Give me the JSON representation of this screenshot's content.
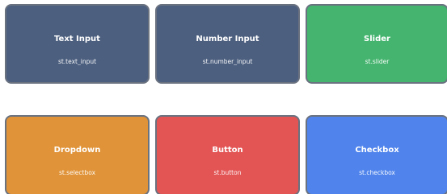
{
  "widgets": [
    {
      "title": "Text Input",
      "code": "st.text_input",
      "color": "#4c5f7f"
    },
    {
      "title": "Number Input",
      "code": "st.number_input",
      "color": "#4c5f7f"
    },
    {
      "title": "Slider",
      "code": "st.slider",
      "color": "#45b46f"
    },
    {
      "title": "Dropdown",
      "code": "st.selectbox",
      "color": "#e09338"
    },
    {
      "title": "Button",
      "code": "st.button",
      "color": "#e35454"
    },
    {
      "title": "Checkbox",
      "code": "st.checkbox",
      "color": "#5084ec"
    }
  ]
}
